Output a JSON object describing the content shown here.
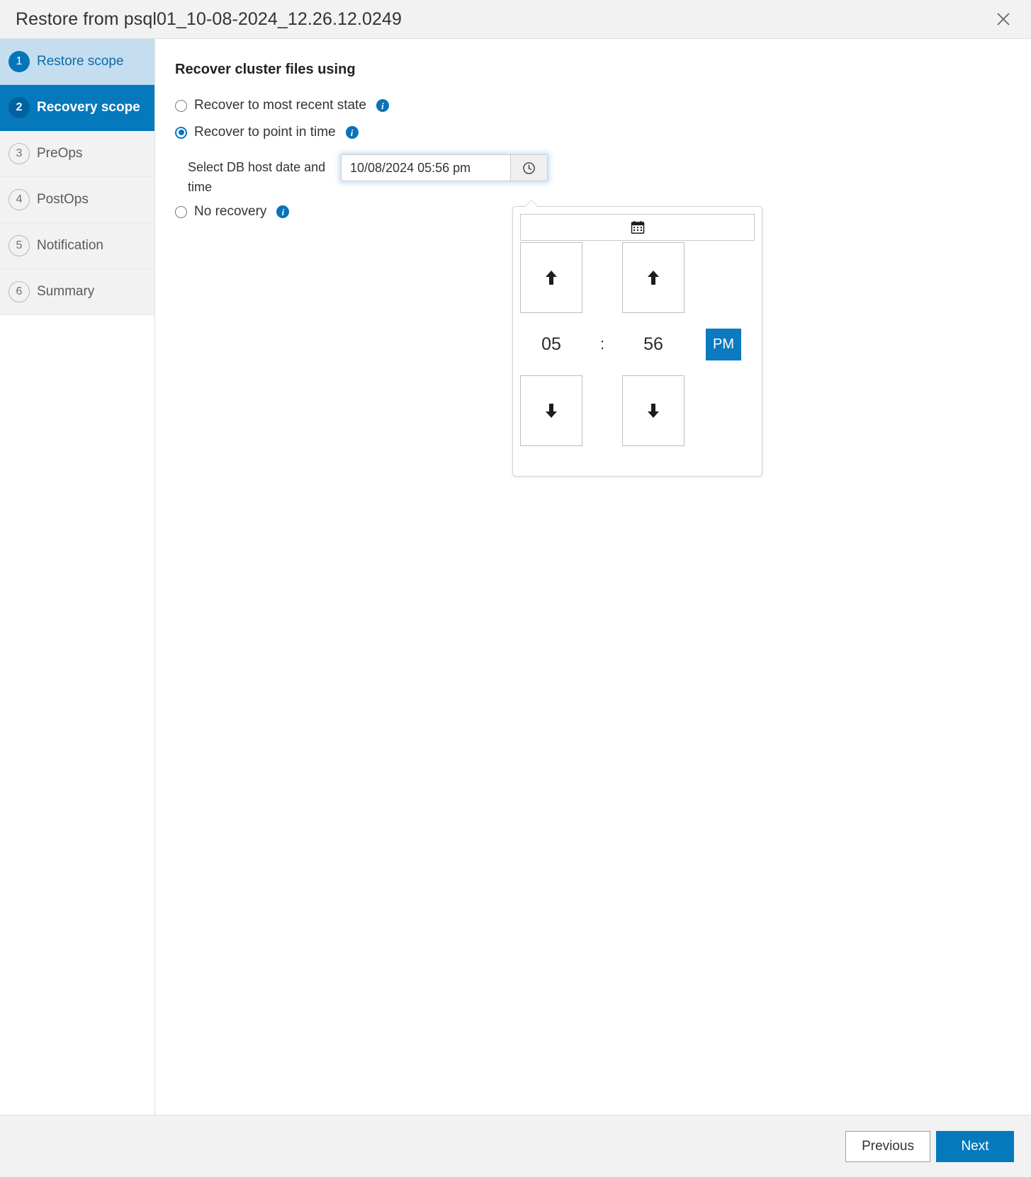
{
  "titlebar": {
    "title": "Restore from psql01_10-08-2024_12.26.12.0249",
    "close_icon": "close-icon"
  },
  "sidebar": {
    "steps": [
      {
        "number": "1",
        "label": "Restore scope",
        "state": "done"
      },
      {
        "number": "2",
        "label": "Recovery scope",
        "state": "active"
      },
      {
        "number": "3",
        "label": "PreOps",
        "state": "pending"
      },
      {
        "number": "4",
        "label": "PostOps",
        "state": "pending"
      },
      {
        "number": "5",
        "label": "Notification",
        "state": "pending"
      },
      {
        "number": "6",
        "label": "Summary",
        "state": "pending"
      }
    ]
  },
  "main": {
    "heading": "Recover cluster files using",
    "options": [
      {
        "label": "Recover to most recent state",
        "selected": false,
        "info": "info-icon"
      },
      {
        "label": "Recover to point in time",
        "selected": true,
        "info": "info-icon"
      },
      {
        "label": "No recovery",
        "selected": false,
        "info": "info-icon"
      }
    ],
    "datetime_field": {
      "label": "Select DB host date and time",
      "value": "10/08/2024 05:56 pm",
      "placeholder": "mm/dd/yyyy hh:mm am",
      "clock_icon": "clock-icon"
    }
  },
  "timepicker": {
    "calendar_icon": "calendar-icon",
    "hour_up_icon": "arrow-up-icon",
    "minute_up_icon": "arrow-up-icon",
    "hour_down_icon": "arrow-down-icon",
    "minute_down_icon": "arrow-down-icon",
    "hour": "05",
    "separator": ":",
    "minute": "56",
    "meridiem": "PM"
  },
  "footer": {
    "previous_label": "Previous",
    "next_label": "Next"
  },
  "colors": {
    "accent": "#0679bd",
    "accent_dark": "#00629e",
    "step_done_bg": "#c4def0",
    "titlebar_bg": "#f2f2f2",
    "footer_bg": "#f2f2f2"
  }
}
